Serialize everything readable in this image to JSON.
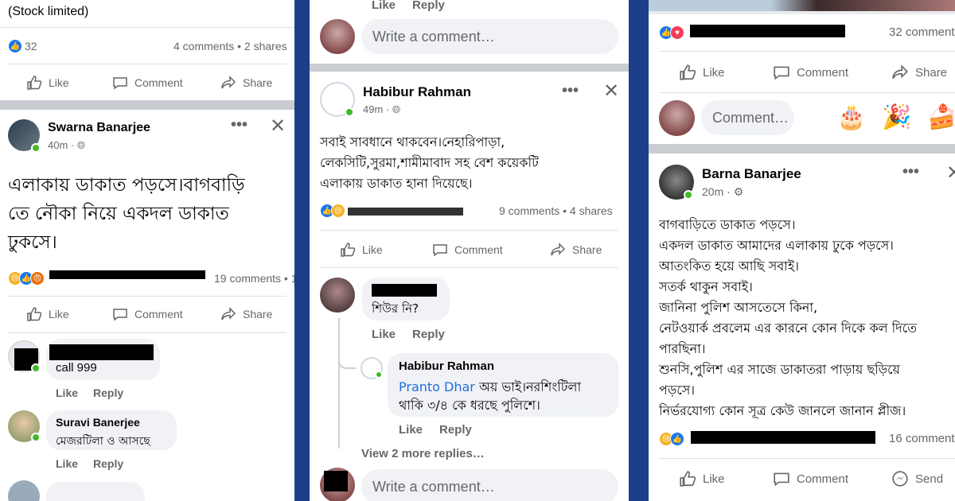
{
  "panel1": {
    "top_post": {
      "text_line": "(Stock limited)",
      "reaction_count": "32",
      "stats": "4 comments • 2 shares"
    },
    "actions": {
      "like": "Like",
      "comment": "Comment",
      "share": "Share"
    },
    "post": {
      "author": "Swarna Banarjee",
      "time": "40m ·",
      "body_lines": [
        "এলাকায় ডাকাত পড়সে।বাগবাড়ি",
        "তে নৌকা নিয়ে একদল ডাকাত",
        "ঢুকসে।"
      ],
      "stats": "19 comments • 1",
      "more_icon": "more-horizontal",
      "close_icon": "close"
    },
    "comments": [
      {
        "text": "call 999",
        "like": "Like",
        "reply": "Reply"
      },
      {
        "author": "Suravi Banerjee",
        "text": "মেজরটিলা ও আসছে",
        "like": "Like",
        "reply": "Reply"
      }
    ]
  },
  "panel2": {
    "top_links": {
      "like": "Like",
      "reply": "Reply"
    },
    "write_comment": "Write a comment…",
    "post": {
      "author": "Habibur Rahman",
      "time": "49m ·",
      "body_lines": [
        "সবাই সাবধানে থাকবেন।নেহারিপাড়া,",
        "লেকসিটি,সুরমা,শামীমাবাদ সহ বেশ কয়েকটি",
        "এলাকায় ডাকাত হানা দিয়েছে।"
      ],
      "stats": "9 comments • 4 shares"
    },
    "actions": {
      "like": "Like",
      "comment": "Comment",
      "share": "Share"
    },
    "comment": {
      "text": "শিউর নি?",
      "like": "Like",
      "reply": "Reply"
    },
    "reply": {
      "author": "Habibur Rahman",
      "mention": "Pranto Dhar",
      "text_line1": " অয় ভাই।নরশিংটিলা",
      "text_line2": "থাকি ৩/৪ কে ধরছে পুলিশে।",
      "like": "Like",
      "reply": "Reply"
    },
    "view_more": "View 2 more replies…",
    "write_comment_bottom": "Write a comment…"
  },
  "panel3": {
    "top_stats": "32 comment",
    "actions": {
      "like": "Like",
      "comment": "Comment",
      "share": "Share"
    },
    "comment_box": "Comment…",
    "post": {
      "author": "Barna Banarjee",
      "time": "20m ·",
      "body_lines": [
        "বাগবাড়িতে ডাকাত পড়সে।",
        "একদল ডাকাত আমাদের এলাকায় ঢুকে পড়সে।",
        "আতংকিত হয়ে আছি সবাই।",
        "সতর্ক থাকুন সবাই।",
        "জানিনা পুলিশ আসতেসে কিনা,",
        "নেটওয়ার্ক প্রবলেম এর কারনে কোন দিকে কল দিতে",
        "পারছিনা।",
        "শুনসি,পুলিশ এর সাজে ডাকাতরা পাড়ায় ছড়িয়ে",
        "পড়সে।",
        "নির্ভরযোগ্য কোন সূত্র কেউ জানলে জানান প্লীজ।"
      ],
      "stats": "16 comment"
    },
    "bottom_actions": {
      "like": "Like",
      "comment": "Comment",
      "send": "Send"
    }
  }
}
